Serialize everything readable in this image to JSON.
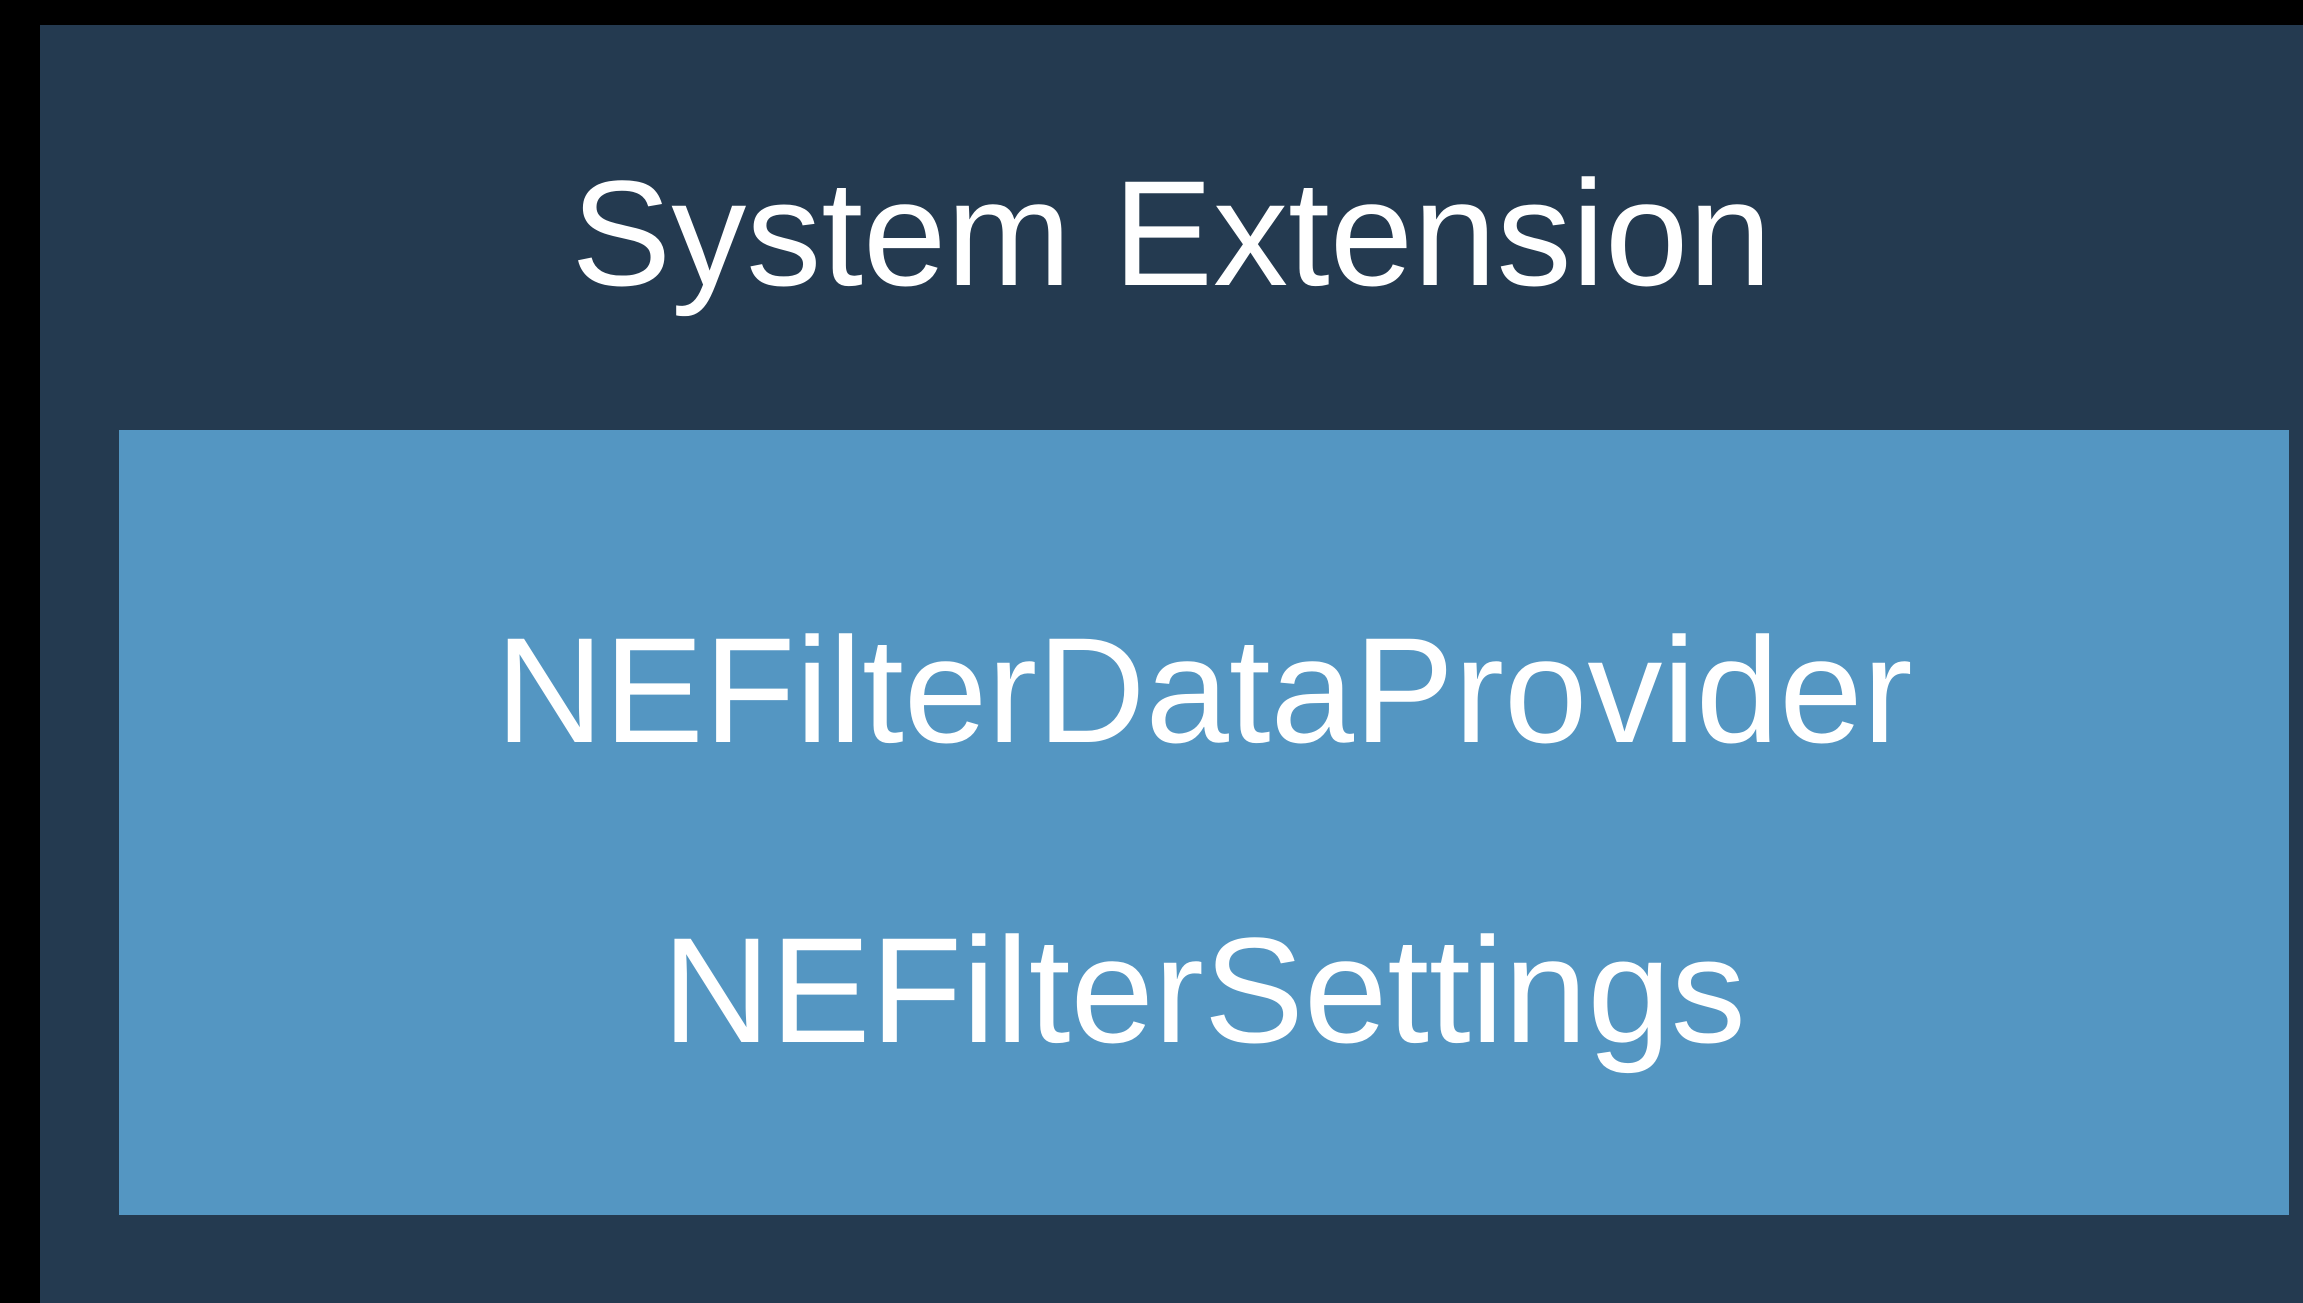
{
  "diagram": {
    "outer_box": {
      "title": "System Extension",
      "color": "#243a50"
    },
    "inner_box": {
      "color": "#5496c2",
      "items": [
        "NEFilterDataProvider",
        "NEFilterSettings"
      ]
    },
    "text_color": "#ffffff",
    "background_color": "#000000"
  }
}
